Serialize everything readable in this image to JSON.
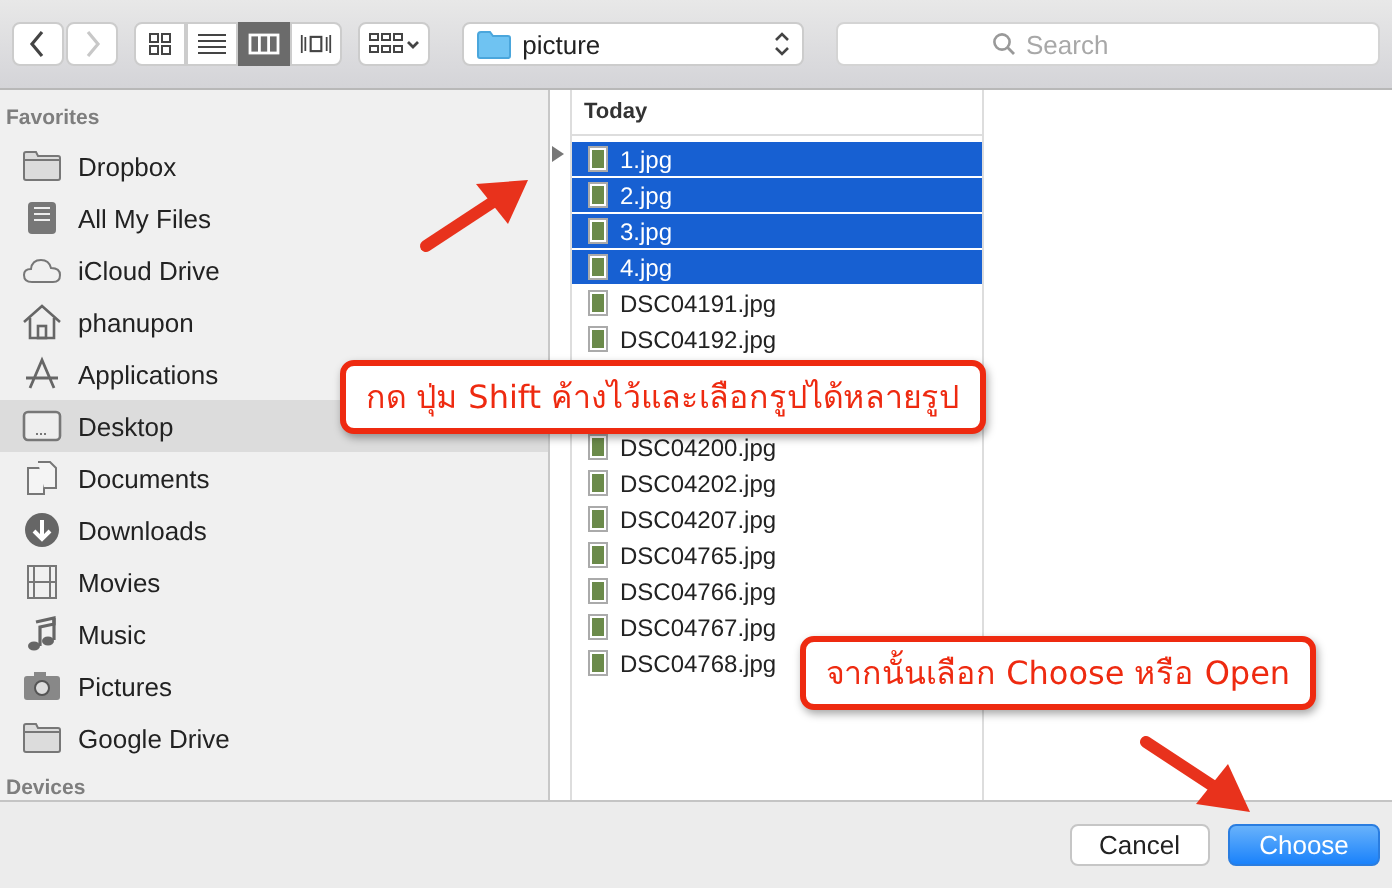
{
  "toolbar": {
    "back": {
      "disabled": false
    },
    "forward": {
      "disabled": true
    },
    "views": [
      {
        "kind": "icons",
        "selected": false
      },
      {
        "kind": "list",
        "selected": false
      },
      {
        "kind": "columns",
        "selected": true
      },
      {
        "kind": "coverflow",
        "selected": false
      }
    ],
    "location": "picture",
    "search": {
      "placeholder": "Search"
    }
  },
  "sidebar": {
    "heading": "Favorites",
    "items": [
      {
        "label": "Dropbox",
        "kind": "folder",
        "selected": false
      },
      {
        "label": "All My Files",
        "kind": "files",
        "selected": false
      },
      {
        "label": "iCloud Drive",
        "kind": "cloud",
        "selected": false
      },
      {
        "label": "phanupon",
        "kind": "home",
        "selected": false
      },
      {
        "label": "Applications",
        "kind": "apps",
        "selected": false
      },
      {
        "label": "Desktop",
        "kind": "desktop",
        "selected": true
      },
      {
        "label": "Documents",
        "kind": "documents",
        "selected": false
      },
      {
        "label": "Downloads",
        "kind": "downloads",
        "selected": false
      },
      {
        "label": "Movies",
        "kind": "movies",
        "selected": false
      },
      {
        "label": "Music",
        "kind": "music",
        "selected": false
      },
      {
        "label": "Pictures",
        "kind": "pictures",
        "selected": false
      },
      {
        "label": "Google Drive",
        "kind": "folder",
        "selected": false
      }
    ],
    "heading_2": "Devices"
  },
  "files": {
    "heading": "Today",
    "rows_above": [
      {
        "name": "1.jpg",
        "selected": true
      },
      {
        "name": "2.jpg",
        "selected": true
      },
      {
        "name": "3.jpg",
        "selected": true
      },
      {
        "name": "4.jpg",
        "selected": true
      },
      {
        "name": "DSC04191.jpg",
        "selected": false
      },
      {
        "name": "DSC04192.jpg",
        "selected": false
      }
    ],
    "rows_below": [
      {
        "name": "DSC04200.jpg",
        "selected": false
      },
      {
        "name": "DSC04202.jpg",
        "selected": false
      },
      {
        "name": "DSC04207.jpg",
        "selected": false
      },
      {
        "name": "DSC04765.jpg",
        "selected": false
      },
      {
        "name": "DSC04766.jpg",
        "selected": false
      },
      {
        "name": "DSC04767.jpg",
        "selected": false
      },
      {
        "name": "DSC04768.jpg",
        "selected": false
      }
    ]
  },
  "callouts": [
    "กด ปุ่ม Shift ค้างไว้และเลือกรูปได้หลายรูป",
    "จากนั้นเลือก Choose หรือ Open"
  ],
  "buttons": [
    {
      "label": "Cancel",
      "kind": "default"
    },
    {
      "label": "Choose",
      "kind": "primary"
    }
  ]
}
